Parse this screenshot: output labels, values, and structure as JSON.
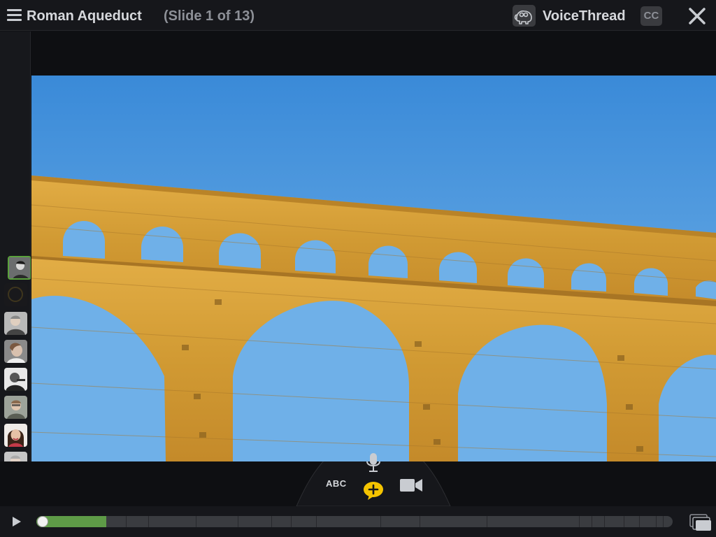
{
  "header": {
    "title": "Roman Aqueduct",
    "slide_info": "(Slide 1 of 13)",
    "brand": "VoiceThread",
    "cc_label": "CC"
  },
  "sidebar": {
    "avatars": [
      {
        "name": "avatar-commenter-active",
        "active": true
      },
      {
        "name": "avatar-commenter-dim"
      },
      {
        "name": "avatar-commenter-3"
      },
      {
        "name": "avatar-commenter-4"
      },
      {
        "name": "avatar-commenter-5"
      },
      {
        "name": "avatar-commenter-6"
      },
      {
        "name": "avatar-commenter-7"
      },
      {
        "name": "avatar-commenter-8"
      },
      {
        "name": "avatar-commenter-voicethread"
      }
    ]
  },
  "comment_dock": {
    "text_label": "ABC",
    "icons": [
      "microphone-icon",
      "add-comment-icon",
      "video-camera-icon"
    ]
  },
  "player": {
    "progress_fraction": 0.11,
    "slide_count": 13
  },
  "colors": {
    "accent_green": "#5e9b47",
    "add_comment_yellow": "#f5c400",
    "sky_top": "#3a8ad8",
    "sky_bottom": "#7bb8ea",
    "stone": "#d7a138"
  }
}
